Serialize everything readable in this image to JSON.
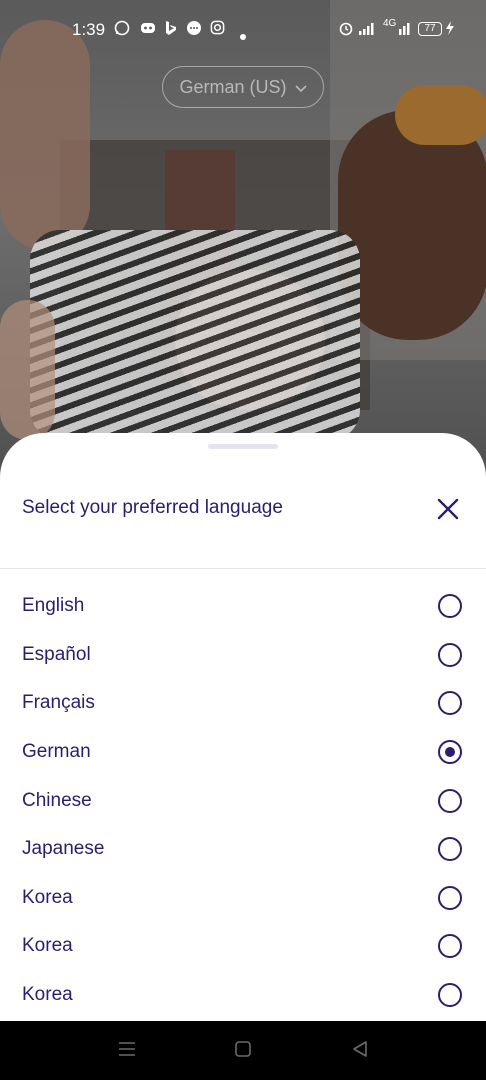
{
  "status_bar": {
    "time": "1:39",
    "signal_text": "4G",
    "battery": "77"
  },
  "language_selector": {
    "current": "German (US)"
  },
  "sheet": {
    "title": "Select your preferred language",
    "languages": [
      {
        "label": "English",
        "selected": false
      },
      {
        "label": "Español",
        "selected": false
      },
      {
        "label": "Français",
        "selected": false
      },
      {
        "label": "German",
        "selected": true
      },
      {
        "label": "Chinese",
        "selected": false
      },
      {
        "label": "Japanese",
        "selected": false
      },
      {
        "label": "Korea",
        "selected": false
      },
      {
        "label": "Korea",
        "selected": false
      },
      {
        "label": "Korea",
        "selected": false
      }
    ]
  },
  "colors": {
    "accent": "#2a1f6b",
    "sheet_bg": "#ffffff",
    "divider": "#e6e6ec"
  }
}
